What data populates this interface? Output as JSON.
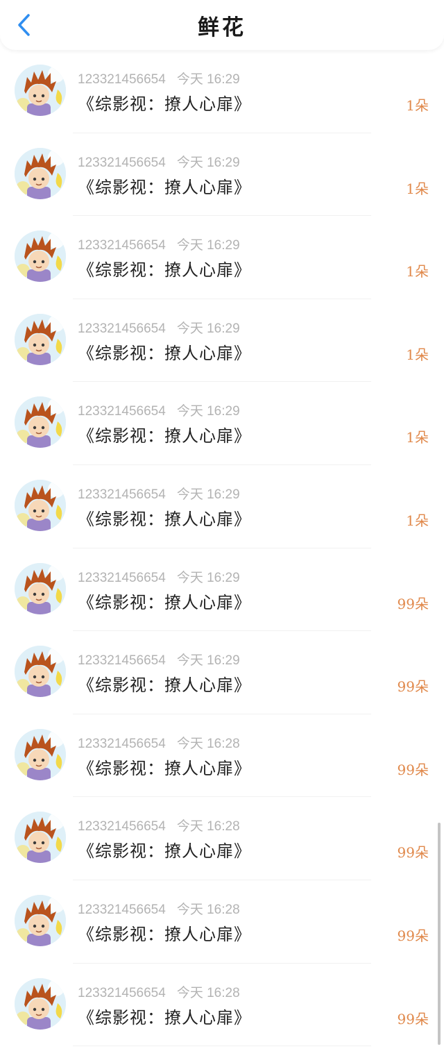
{
  "header": {
    "title": "鲜花",
    "back_icon": "chevron-left-icon",
    "accent_color": "#2f8ef0"
  },
  "count_color": "#e0884a",
  "items": [
    {
      "user": "123321456654",
      "time": "今天 16:29",
      "book": "《综影视：撩人心扉》",
      "count": "1朵"
    },
    {
      "user": "123321456654",
      "time": "今天 16:29",
      "book": "《综影视：撩人心扉》",
      "count": "1朵"
    },
    {
      "user": "123321456654",
      "time": "今天 16:29",
      "book": "《综影视：撩人心扉》",
      "count": "1朵"
    },
    {
      "user": "123321456654",
      "time": "今天 16:29",
      "book": "《综影视：撩人心扉》",
      "count": "1朵"
    },
    {
      "user": "123321456654",
      "time": "今天 16:29",
      "book": "《综影视：撩人心扉》",
      "count": "1朵"
    },
    {
      "user": "123321456654",
      "time": "今天 16:29",
      "book": "《综影视：撩人心扉》",
      "count": "1朵"
    },
    {
      "user": "123321456654",
      "time": "今天 16:29",
      "book": "《综影视：撩人心扉》",
      "count": "99朵"
    },
    {
      "user": "123321456654",
      "time": "今天 16:29",
      "book": "《综影视：撩人心扉》",
      "count": "99朵"
    },
    {
      "user": "123321456654",
      "time": "今天 16:28",
      "book": "《综影视：撩人心扉》",
      "count": "99朵"
    },
    {
      "user": "123321456654",
      "time": "今天 16:28",
      "book": "《综影视：撩人心扉》",
      "count": "99朵"
    },
    {
      "user": "123321456654",
      "time": "今天 16:28",
      "book": "《综影视：撩人心扉》",
      "count": "99朵"
    },
    {
      "user": "123321456654",
      "time": "今天 16:28",
      "book": "《综影视：撩人心扉》",
      "count": "99朵"
    }
  ]
}
